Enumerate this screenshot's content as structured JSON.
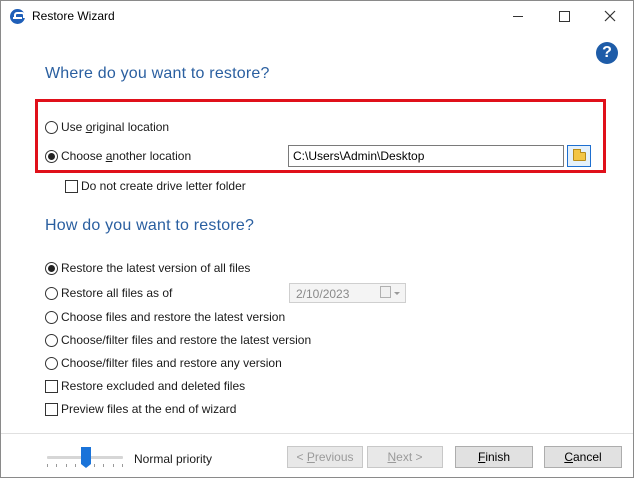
{
  "window": {
    "title": "Restore Wizard"
  },
  "where": {
    "heading": "Where do you want to restore?",
    "original_prefix": "Use ",
    "original_accel": "o",
    "original_suffix": "riginal location",
    "another_prefix": "Choose ",
    "another_accel": "a",
    "another_suffix": "nother location",
    "another_selected": true,
    "path_value": "C:\\Users\\Admin\\Desktop",
    "no_drive_letter_label": "Do not create drive letter folder",
    "highlight_color": "#e0101a"
  },
  "how": {
    "heading": "How do you want to restore?",
    "options": [
      {
        "label": "Restore the latest version of all files",
        "selected": true
      },
      {
        "label": "Restore all files as of",
        "selected": false
      },
      {
        "label": "Choose files and restore the latest version",
        "selected": false
      },
      {
        "label": "Choose/filter files and restore the latest version",
        "selected": false
      },
      {
        "label": "Choose/filter files and restore any version",
        "selected": false
      }
    ],
    "date_value": "2/10/2023",
    "checkboxes": [
      {
        "label": "Restore excluded and deleted files",
        "checked": false
      },
      {
        "label": "Preview files at the end of wizard",
        "checked": false
      }
    ]
  },
  "footer": {
    "priority_label": "Normal priority",
    "priority_level": 0.5,
    "prev_accel": "P",
    "prev_rest": "revious",
    "next_accel": "N",
    "next_rest": "ext >",
    "finish_accel": "F",
    "finish_rest": "inish",
    "cancel_accel": "C",
    "cancel_rest": "ancel"
  },
  "colors": {
    "heading": "#2a5fa0",
    "accent": "#1a73d9",
    "help_icon": "#1e5ca8"
  }
}
